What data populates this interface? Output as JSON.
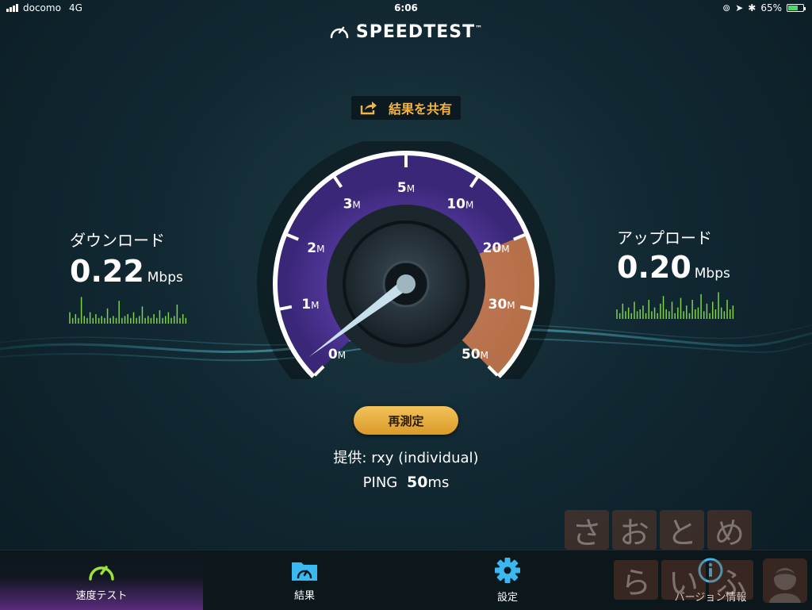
{
  "status_bar": {
    "carrier": "docomo",
    "network": "4G",
    "time": "6:06",
    "battery": "65%",
    "battery_level": 0.65
  },
  "header": {
    "title": "SPEEDTEST",
    "trademark": "™"
  },
  "share": {
    "label": "結果を共有",
    "icon": "share-icon"
  },
  "download": {
    "label": "ダウンロード",
    "value": "0.22",
    "unit": "Mbps",
    "sparkline": [
      6,
      3,
      5,
      3,
      14,
      4,
      3,
      6,
      3,
      5,
      3,
      4,
      3,
      8,
      3,
      4,
      3,
      12,
      3,
      4,
      5,
      3,
      6,
      3,
      4,
      9,
      3,
      4,
      3,
      5,
      3,
      7,
      3,
      4,
      6,
      3,
      4,
      10,
      3,
      5,
      3
    ]
  },
  "upload": {
    "label": "アップロード",
    "value": "0.20",
    "unit": "Mbps",
    "sparkline": [
      5,
      3,
      8,
      4,
      6,
      3,
      9,
      4,
      5,
      7,
      3,
      10,
      4,
      6,
      3,
      8,
      12,
      5,
      4,
      9,
      3,
      6,
      11,
      4,
      7,
      3,
      10,
      5,
      6,
      13,
      4,
      8,
      3,
      9,
      5,
      14,
      6,
      4,
      10,
      5,
      7
    ]
  },
  "gauge": {
    "ticks": [
      {
        "num": "0",
        "unit": "M"
      },
      {
        "num": "1",
        "unit": "M"
      },
      {
        "num": "2",
        "unit": "M"
      },
      {
        "num": "3",
        "unit": "M"
      },
      {
        "num": "5",
        "unit": "M"
      },
      {
        "num": "10",
        "unit": "M"
      },
      {
        "num": "20",
        "unit": "M"
      },
      {
        "num": "30",
        "unit": "M"
      },
      {
        "num": "50",
        "unit": "M"
      }
    ],
    "needle_fraction": 0.03
  },
  "retest_label": "再測定",
  "provider": {
    "prefix": "提供: ",
    "name": "rxy (individual)"
  },
  "ping": {
    "label": "PING",
    "value": "50",
    "unit": "ms"
  },
  "watermark": {
    "row1": [
      "さ",
      "お",
      "と",
      "め"
    ],
    "row2": [
      "ら",
      "い",
      "ふ"
    ]
  },
  "tabs": [
    {
      "label": "速度テスト",
      "icon": "speedometer-icon",
      "active": true
    },
    {
      "label": "結果",
      "icon": "results-folder-icon",
      "active": false
    },
    {
      "label": "設定",
      "icon": "gear-icon",
      "active": false
    },
    {
      "label": "バージョン情報",
      "icon": "info-icon",
      "active": false
    }
  ],
  "colors": {
    "accent_orange": "#f5b442",
    "gauge_purple": "#5a3aa8",
    "gauge_orange": "#e08a3a",
    "spark_green": "#7fd24a",
    "tab_active_green": "#9be23a",
    "tab_icon_blue": "#3ab8f0"
  }
}
